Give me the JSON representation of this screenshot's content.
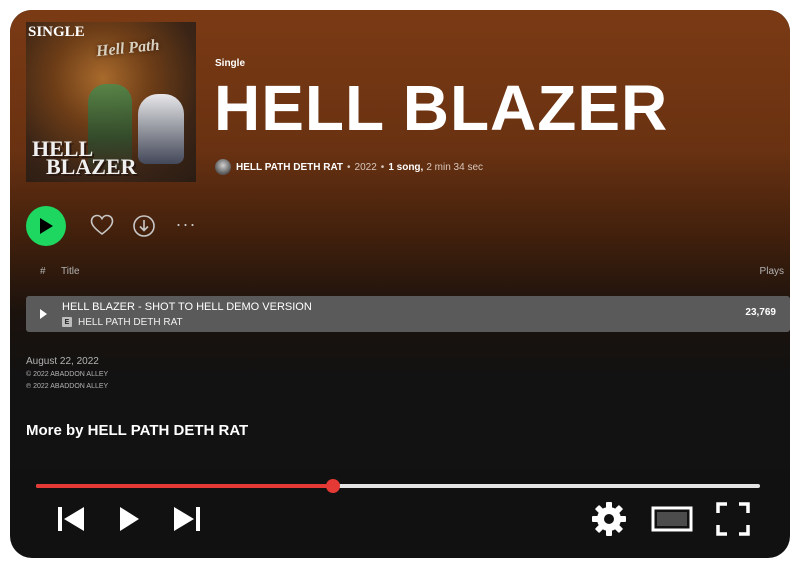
{
  "album": {
    "cover_single_tag": "SINGLE",
    "cover_logo_text": "Hell Path",
    "cover_title_line1": "HELL",
    "cover_title_line2": "BLAZER",
    "kind": "Single",
    "title": "HELL BLAZER",
    "artist": "HELL PATH DETH RAT",
    "year": "2022",
    "song_count": "1 song,",
    "duration": "2 min 34 sec",
    "separator": "•"
  },
  "actions": {
    "play_icon": "play-icon",
    "like_icon": "heart-icon",
    "download_icon": "download-icon",
    "more_label": "···"
  },
  "tracklist": {
    "headers": {
      "number": "#",
      "title": "Title",
      "plays": "Plays"
    },
    "tracks": [
      {
        "title": "HELL BLAZER - SHOT TO HELL DEMO VERSION",
        "artist": "HELL PATH DETH RAT",
        "explicit_badge": "E",
        "plays": "23,769"
      }
    ]
  },
  "release": {
    "date": "August 22, 2022",
    "copyright_c": "© 2022 ABADDON ALLEY",
    "copyright_p": "℗ 2022 ABADDON ALLEY"
  },
  "more_by": {
    "heading": "More by HELL PATH DETH RAT"
  },
  "player": {
    "progress": 0.41,
    "fill_color": "#e53935",
    "track_color": "#e4e4e4",
    "controls": [
      "previous-icon",
      "play-icon",
      "next-icon",
      "settings-gear-icon",
      "theater-mode-icon",
      "fullscreen-icon"
    ]
  },
  "colors": {
    "accent_green": "#1ed760",
    "header_brown": "#7a3a14",
    "background": "#121212"
  }
}
